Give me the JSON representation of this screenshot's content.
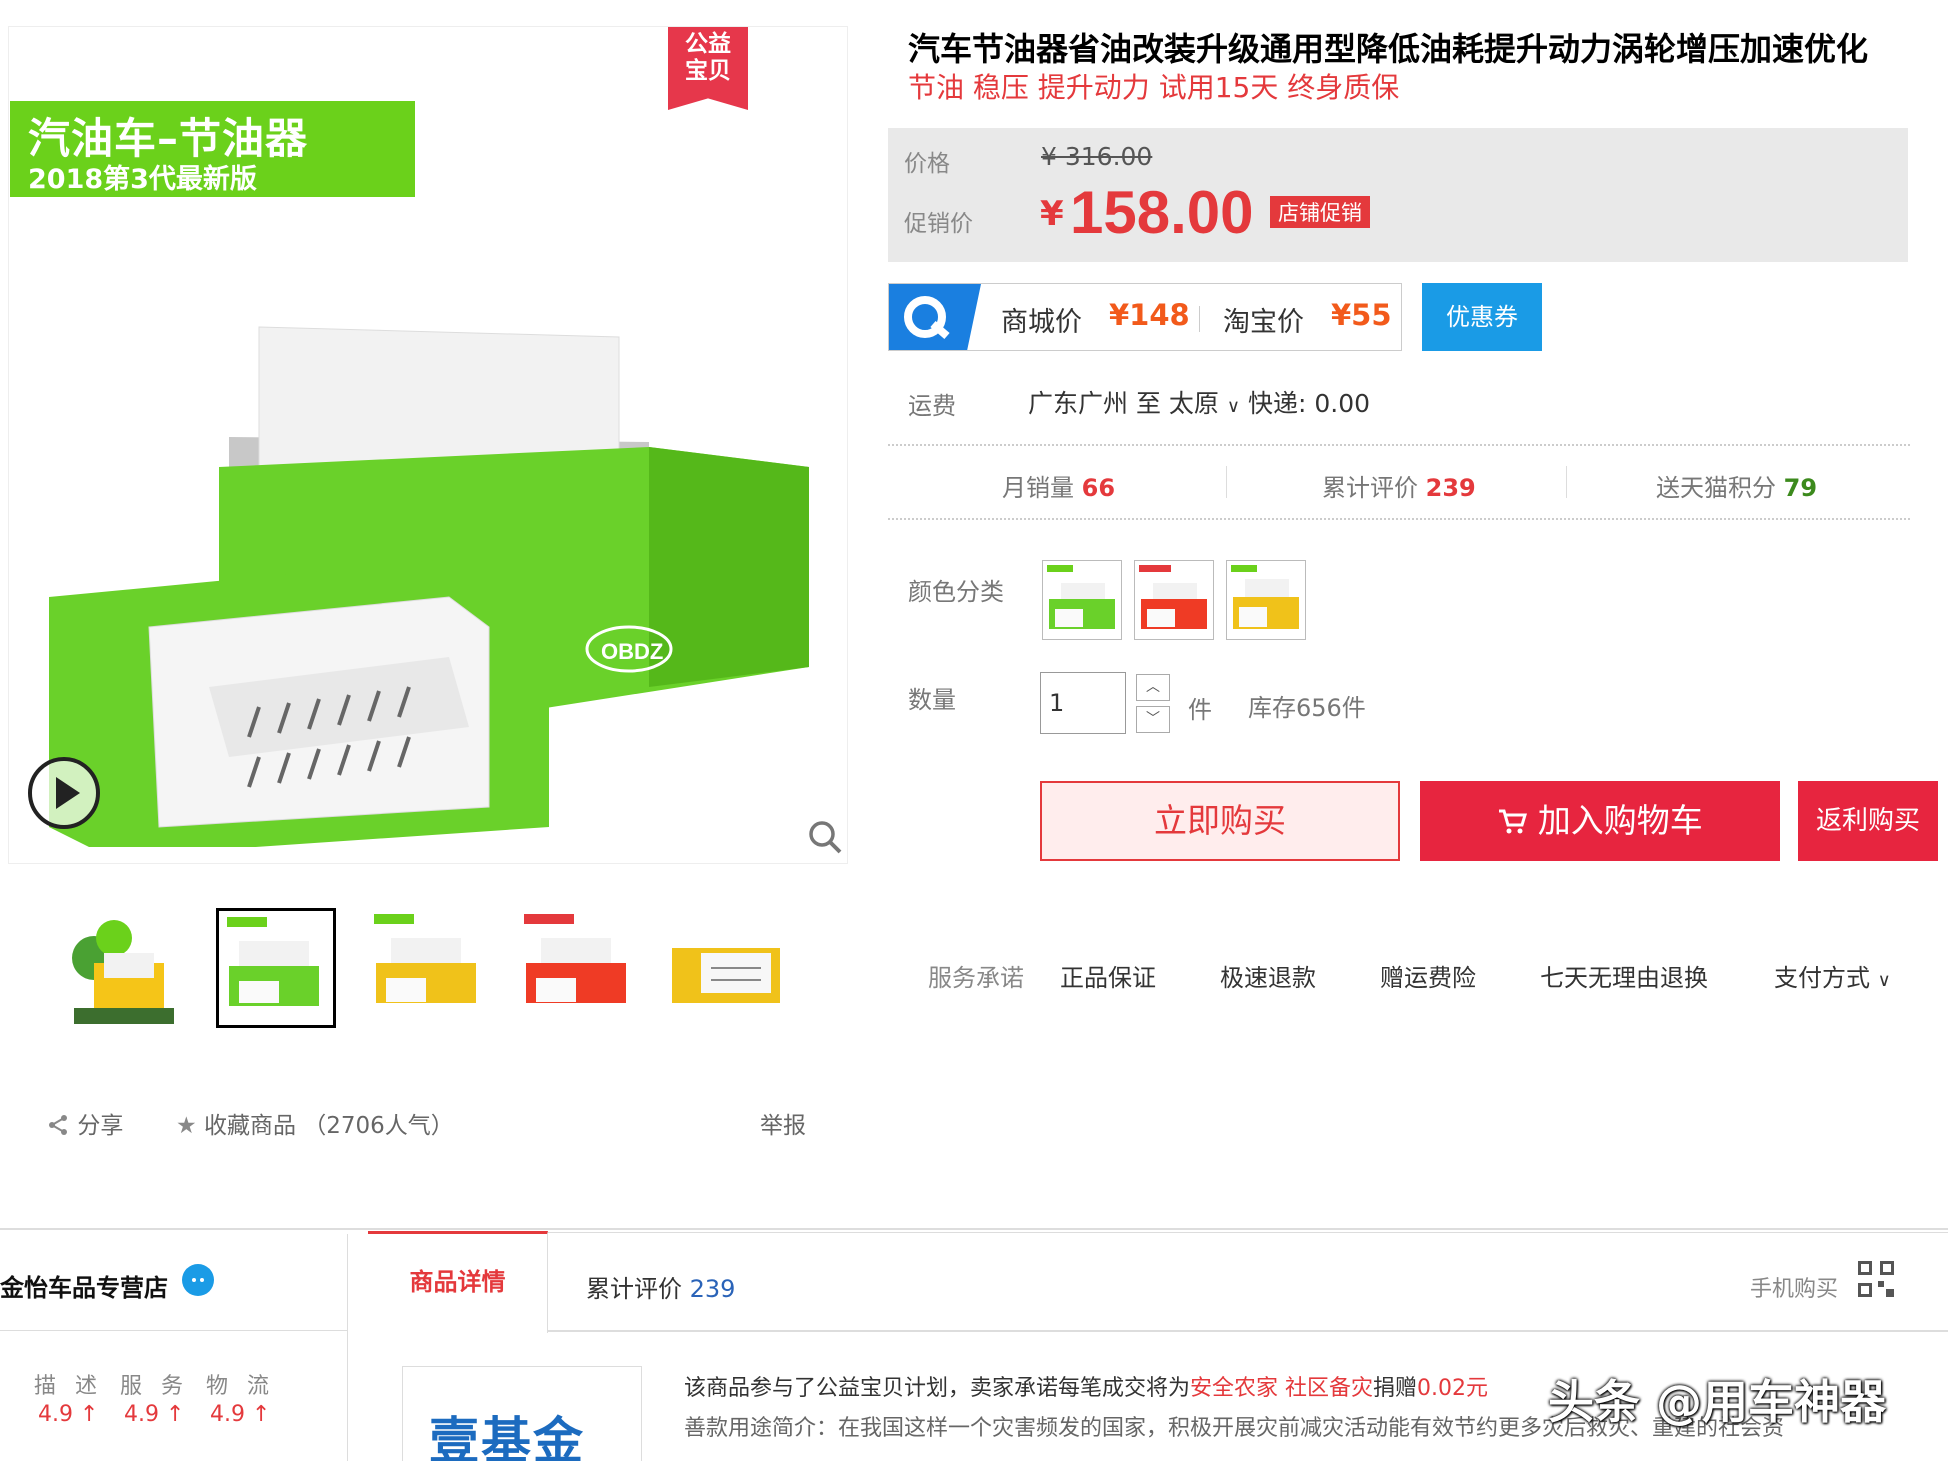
{
  "main_image": {
    "banner_line1": "汽油车–节油器",
    "banner_line2": "2018第3代最新版",
    "charity_ribbon": "公益宝贝",
    "device_brand": "OBDZ"
  },
  "colors": {
    "accent": "#e4393c",
    "green": "#6bd11b",
    "blue": "#1a9be6"
  },
  "share_bar": {
    "share_label": "分享",
    "favorite_label": "收藏商品",
    "favorite_count": "（2706人气）",
    "report_label": "举报"
  },
  "product": {
    "title": "汽车节油器省油改装升级通用型降低油耗提升动力涡轮增压加速优化",
    "subtitle": "节油 稳压 提升动力 试用15天 终身质保"
  },
  "price": {
    "original_label": "价格",
    "original_value": "¥ 316.00",
    "promo_label": "促销价",
    "currency": "¥",
    "promo_value": "158.00",
    "promo_tag": "店铺促销"
  },
  "compare": {
    "mall_label": "商城价",
    "mall_value": "¥148",
    "taobao_label": "淘宝价",
    "taobao_value": "¥55",
    "coupon_label": "优惠券"
  },
  "shipping": {
    "label": "运费",
    "text": "广东广州  至 太原",
    "express": "快递: 0.00"
  },
  "stats": {
    "monthly_label": "月销量",
    "monthly_value": "66",
    "reviews_label": "累计评价",
    "reviews_value": "239",
    "points_label": "送天猫积分",
    "points_value": "79"
  },
  "options": {
    "color_label": "颜色分类",
    "swatches": [
      "green",
      "red",
      "yellow"
    ],
    "quantity_label": "数量",
    "quantity_value": "1",
    "unit": "件",
    "stock": "库存656件"
  },
  "actions": {
    "buy_now": "立即购买",
    "add_to_cart": "加入购物车",
    "rebate": "返利购买"
  },
  "services": {
    "label": "服务承诺",
    "items": [
      "正品保证",
      "极速退款",
      "赠运费险",
      "七天无理由退换"
    ],
    "payment": "支付方式"
  },
  "store": {
    "name": "金怡车品专营店",
    "labels": [
      "描 述",
      "服 务",
      "物 流"
    ],
    "scores": [
      "4.9",
      "4.9",
      "4.9"
    ]
  },
  "tabs": {
    "details": "商品详情",
    "reviews": "累计评价",
    "reviews_count": "239",
    "mobile_buy": "手机购买"
  },
  "description": {
    "logo_text": "壹基金",
    "line1_a": "该商品参与了公益宝贝计划，卖家承诺每笔成交将为",
    "line1_b": "安全农家 社区备灾",
    "line1_c": "捐赠",
    "line1_d": "0.02元",
    "line2": "善款用途简介：在我国这样一个灾害频发的国家，积极开展灾前减灾活动能有效节约更多灾后救灾、重建的社会资",
    "watermark": "头条 @用车神器"
  }
}
